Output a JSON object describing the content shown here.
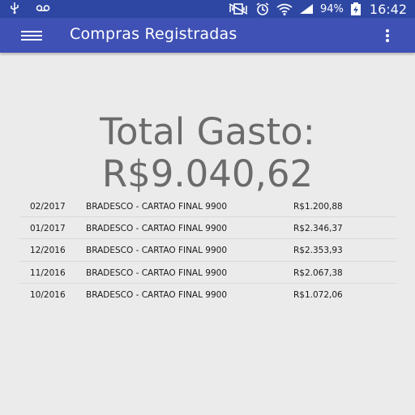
{
  "status_bar": {
    "battery_percent": "94%",
    "time": "16:42",
    "icons": [
      "usb-icon",
      "voicemail-icon",
      "vibrate-icon",
      "alarm-icon",
      "wifi-icon",
      "signal-icon",
      "battery-charging-icon"
    ]
  },
  "app_bar": {
    "title": "Compras Registradas",
    "color": "#3f51b5",
    "menu_icon": "menu-icon",
    "overflow_icon": "more-vert-icon"
  },
  "summary": {
    "label": "Total Gasto:",
    "value": "R$9.040,62"
  },
  "purchases": [
    {
      "date": "02/2017",
      "description": "BRADESCO - CARTAO FINAL 9900",
      "value": "R$1.200,88"
    },
    {
      "date": "01/2017",
      "description": "BRADESCO - CARTAO FINAL 9900",
      "value": "R$2.346,37"
    },
    {
      "date": "12/2016",
      "description": "BRADESCO - CARTAO FINAL 9900",
      "value": "R$2.353,93"
    },
    {
      "date": "11/2016",
      "description": "BRADESCO - CARTAO FINAL 9900",
      "value": "R$2.067,38"
    },
    {
      "date": "10/2016",
      "description": "BRADESCO - CARTAO FINAL 9900",
      "value": "R$1.072,06"
    }
  ]
}
